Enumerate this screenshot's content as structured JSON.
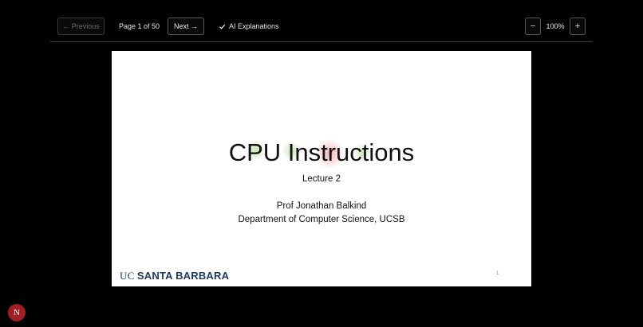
{
  "toolbar": {
    "previous_label": "← Previous",
    "page_info": "Page 1 of 50",
    "next_label": "Next →",
    "ai_label": "AI Explanations",
    "ai_checked": true,
    "zoom_out_label": "−",
    "zoom_level": "100%",
    "zoom_in_label": "+"
  },
  "slide": {
    "title": "CPU Instructions",
    "subtitle": "Lecture 2",
    "author": "Prof Jonathan Balkind",
    "department": "Department of Computer Science, UCSB",
    "logo_uc": "UC",
    "logo_name": "SANTA BARBARA",
    "page_number": "1"
  },
  "avatar": {
    "initial": "N"
  },
  "colors": {
    "background": "#000000",
    "logo": "#1c3b63",
    "avatar": "#a11f24",
    "highlight_green": "#a8d58a",
    "highlight_red": "#e48b8b"
  }
}
